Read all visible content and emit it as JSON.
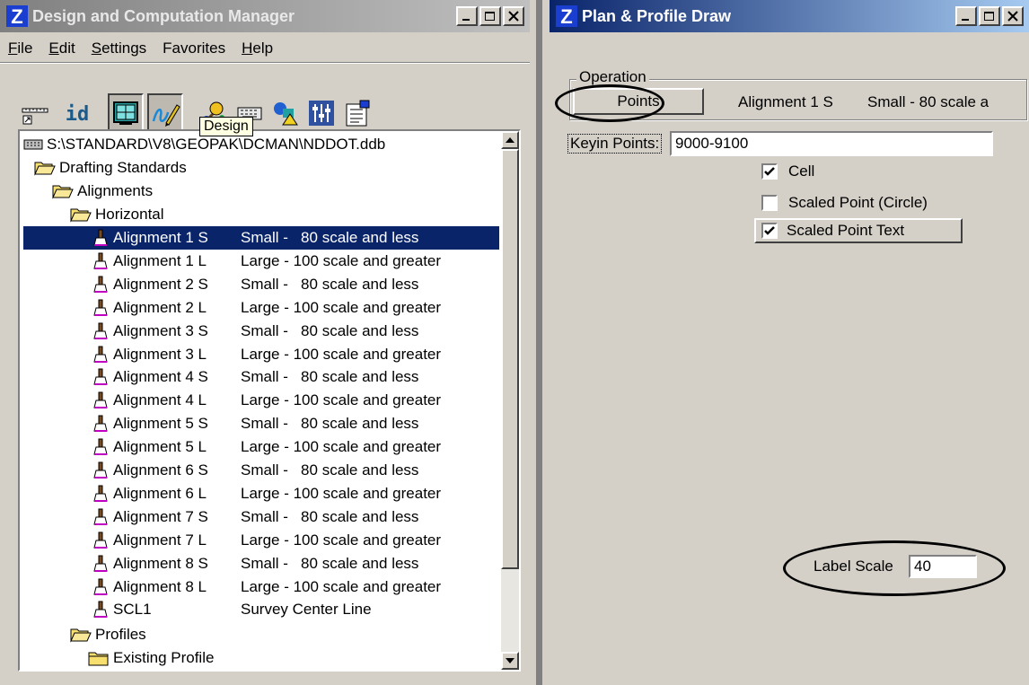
{
  "dcm": {
    "title": "Design and Computation Manager",
    "menu": [
      {
        "first": "F",
        "rest": "ile"
      },
      {
        "first": "E",
        "rest": "dit"
      },
      {
        "first": "S",
        "rest": "ettings"
      },
      {
        "first": "F",
        "rest": "avorites",
        "pre": "",
        "underline_index": 1
      },
      {
        "first": "H",
        "rest": "elp"
      }
    ],
    "tooltip": "Design",
    "toolbar_icons": [
      "ruler-icon",
      "id-icon",
      "grid-icon",
      "draw-pencil-icon",
      "palette-icon",
      "keyboard-icon",
      "shapes-icon",
      "sliders-icon",
      "properties-icon"
    ],
    "tree": {
      "root": "S:\\STANDARD\\V8\\GEOPAK\\DCMAN\\NDDOT.ddb",
      "drafting_standards": "Drafting Standards",
      "alignments": "Alignments",
      "horizontal": "Horizontal",
      "items": [
        {
          "name": "Alignment 1 S",
          "desc": "Small -   80 scale and less",
          "selected": true
        },
        {
          "name": "Alignment 1 L",
          "desc": "Large - 100 scale and greater"
        },
        {
          "name": "Alignment 2 S",
          "desc": "Small -   80 scale and less"
        },
        {
          "name": "Alignment 2 L",
          "desc": "Large - 100 scale and greater"
        },
        {
          "name": "Alignment 3 S",
          "desc": "Small -   80 scale and less"
        },
        {
          "name": "Alignment 3 L",
          "desc": "Large - 100 scale and greater"
        },
        {
          "name": "Alignment 4 S",
          "desc": "Small -   80 scale and less"
        },
        {
          "name": "Alignment 4 L",
          "desc": "Large - 100 scale and greater"
        },
        {
          "name": "Alignment 5 S",
          "desc": "Small -   80 scale and less"
        },
        {
          "name": "Alignment 5 L",
          "desc": "Large - 100 scale and greater"
        },
        {
          "name": "Alignment 6 S",
          "desc": "Small -   80 scale and less"
        },
        {
          "name": "Alignment 6 L",
          "desc": "Large - 100 scale and greater"
        },
        {
          "name": "Alignment 7 S",
          "desc": "Small -   80 scale and less"
        },
        {
          "name": "Alignment 7 L",
          "desc": "Large - 100 scale and greater"
        },
        {
          "name": "Alignment 8 S",
          "desc": "Small -   80 scale and less"
        },
        {
          "name": "Alignment 8 L",
          "desc": "Large - 100 scale and greater"
        },
        {
          "name": "SCL1",
          "desc": "Survey Center Line"
        }
      ],
      "profiles": "Profiles",
      "existing_profile": "Existing Profile"
    }
  },
  "ppd": {
    "title": "Plan & Profile Draw",
    "operation_legend": "Operation",
    "points_button": "Points",
    "status_alignment": "Alignment 1 S",
    "status_desc": "Small -   80 scale a",
    "keyin_points_label": "Keyin Points:",
    "keyin_points_value": "9000-9100",
    "cell_label": "Cell",
    "cell_checked": true,
    "scaled_point_circle_label": "Scaled Point (Circle)",
    "scaled_point_circle_checked": false,
    "scaled_point_text_label": "Scaled Point Text",
    "scaled_point_text_checked": true,
    "label_scale_label": "Label Scale",
    "label_scale_value": "40"
  },
  "colors": {
    "active_title": "#0a246a",
    "inactive_title": "#808080",
    "selection": "#0a246a",
    "window_bg": "#d4d0c8"
  }
}
